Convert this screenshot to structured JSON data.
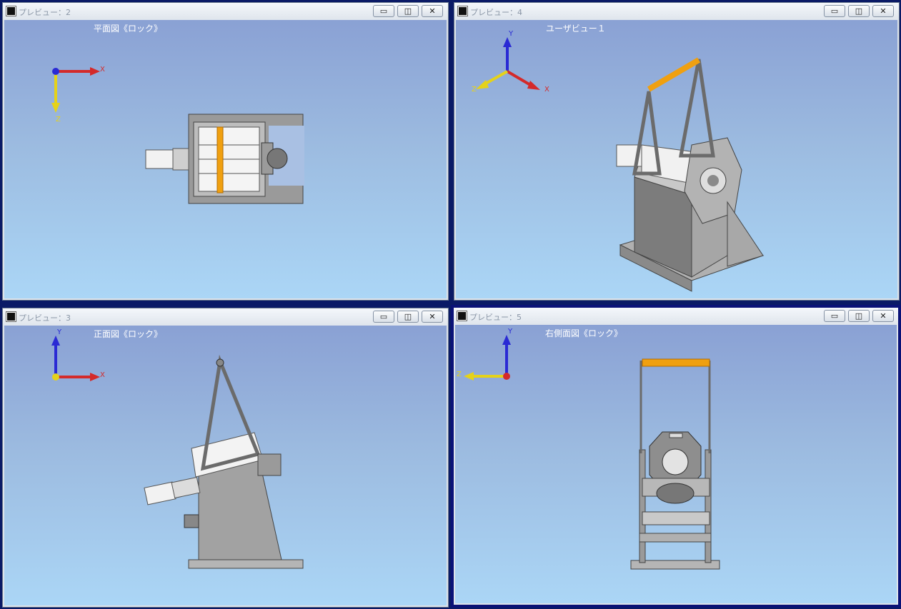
{
  "windows": {
    "w2": {
      "title": "プレビュー：2",
      "view_label": "平面図《ロック》",
      "axes": {
        "x": "X",
        "z": "Z"
      }
    },
    "w4": {
      "title": "プレビュー：4",
      "view_label": "ユーザビュー１",
      "axes": {
        "x": "X",
        "y": "Y",
        "z": "Z"
      }
    },
    "w3": {
      "title": "プレビュー：3",
      "view_label": "正面図《ロック》",
      "axes": {
        "x": "X",
        "y": "Y"
      }
    },
    "w5": {
      "title": "プレビュー：5",
      "view_label": "右側面図《ロック》",
      "axes": {
        "y": "Y",
        "z": "Z"
      }
    }
  },
  "buttons": {
    "minimize_icon": "minimize-icon",
    "maximize_icon": "maximize-icon",
    "close_icon": "close-icon"
  },
  "colors": {
    "active_border": "#0a1277",
    "axis_x": "#d42a2a",
    "axis_y": "#2a2ad4",
    "axis_z": "#e5d21a",
    "handle": "#f0a010",
    "model_gray": "#8c8c8c"
  }
}
